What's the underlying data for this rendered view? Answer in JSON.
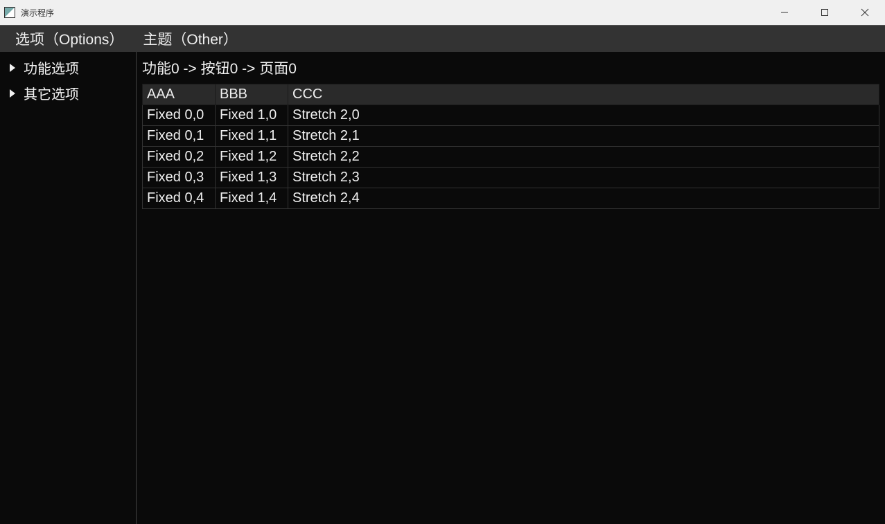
{
  "window": {
    "title": "演示程序"
  },
  "menubar": {
    "items": [
      {
        "label": "选项（Options）"
      },
      {
        "label": "主题（Other）"
      }
    ]
  },
  "sidebar": {
    "items": [
      {
        "label": "功能选项"
      },
      {
        "label": "其它选项"
      }
    ]
  },
  "breadcrumb": "功能0 -> 按钮0 -> 页面0",
  "table": {
    "headers": [
      "AAA",
      "BBB",
      "CCC"
    ],
    "rows": [
      {
        "a": "Fixed 0,0",
        "b": "Fixed 1,0",
        "c": "Stretch 2,0"
      },
      {
        "a": "Fixed 0,1",
        "b": "Fixed 1,1",
        "c": "Stretch 2,1"
      },
      {
        "a": "Fixed 0,2",
        "b": "Fixed 1,2",
        "c": "Stretch 2,2"
      },
      {
        "a": "Fixed 0,3",
        "b": "Fixed 1,3",
        "c": "Stretch 2,3"
      },
      {
        "a": "Fixed 0,4",
        "b": "Fixed 1,4",
        "c": "Stretch 2,4"
      }
    ]
  }
}
